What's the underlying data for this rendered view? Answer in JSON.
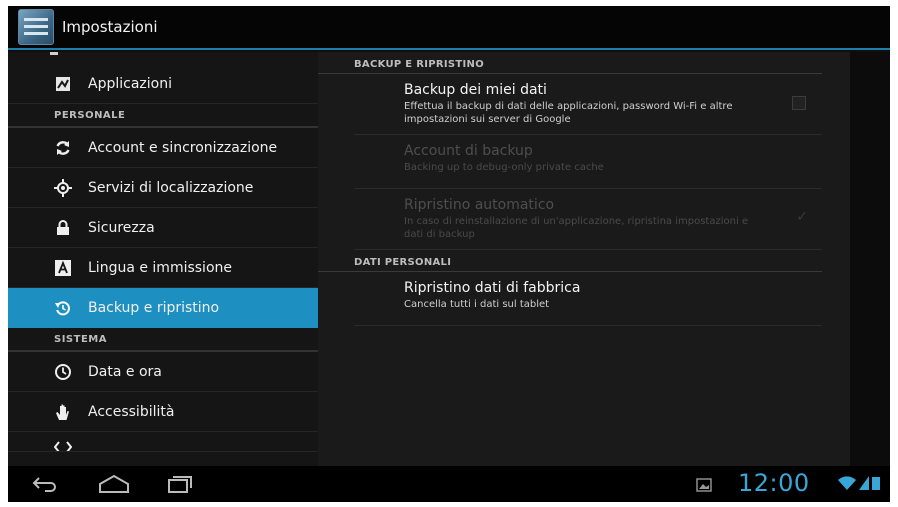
{
  "action_bar": {
    "title": "Impostazioni"
  },
  "sidebar": {
    "items": [
      {
        "type": "item",
        "label": "Applicazioni",
        "icon": "apps-icon"
      },
      {
        "type": "header",
        "label": "PERSONALE"
      },
      {
        "type": "item",
        "label": "Account e sincronizzazione",
        "icon": "sync-icon"
      },
      {
        "type": "item",
        "label": "Servizi di localizzazione",
        "icon": "location-icon"
      },
      {
        "type": "item",
        "label": "Sicurezza",
        "icon": "lock-icon"
      },
      {
        "type": "item",
        "label": "Lingua e immissione",
        "icon": "keyboard-icon"
      },
      {
        "type": "item",
        "label": "Backup e ripristino",
        "icon": "backup-icon",
        "active": true
      },
      {
        "type": "header",
        "label": "SISTEMA"
      },
      {
        "type": "item",
        "label": "Data e ora",
        "icon": "clock-icon"
      },
      {
        "type": "item",
        "label": "Accessibilità",
        "icon": "hand-icon"
      }
    ]
  },
  "content": {
    "backup_section": "BACKUP E RIPRISTINO",
    "backup_data": {
      "title": "Backup dei miei dati",
      "subtitle": "Effettua il backup di dati delle applicazioni, password Wi-Fi e altre impostazioni sui server di Google",
      "checked": false
    },
    "backup_account": {
      "title": "Account di backup",
      "subtitle": "Backing up to debug-only private cache"
    },
    "auto_restore": {
      "title": "Ripristino automatico",
      "subtitle": "In caso di reinstallazione di un'applicazione, ripristina impostazioni e dati di backup",
      "checked": true
    },
    "personal_section": "DATI PERSONALI",
    "factory_reset": {
      "title": "Ripristino dati di fabbrica",
      "subtitle": "Cancella tutti i dati sul tablet"
    }
  },
  "system_bar": {
    "clock": "12:00",
    "accent": "#39a6d8"
  }
}
